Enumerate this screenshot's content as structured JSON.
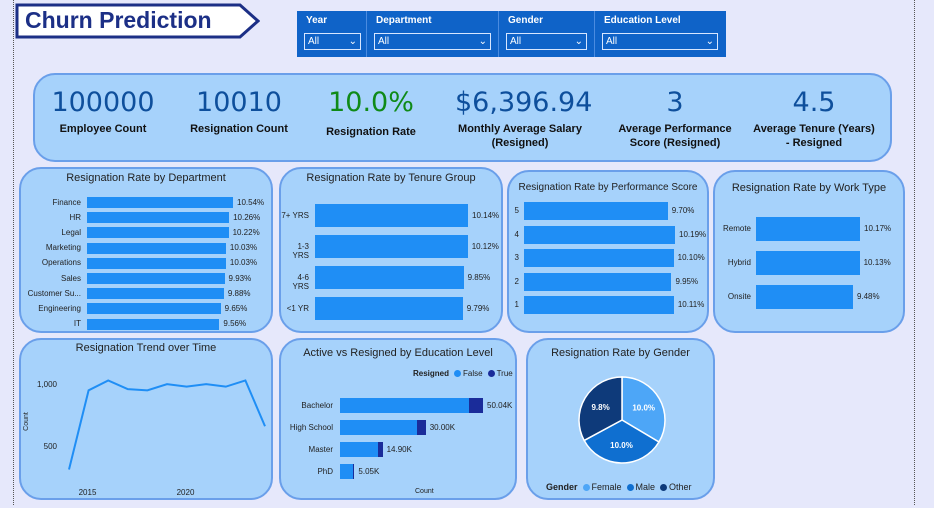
{
  "title": "Churn Prediction",
  "slicers": [
    {
      "label": "Year",
      "value": "All"
    },
    {
      "label": "Department",
      "value": "All"
    },
    {
      "label": "Gender",
      "value": "All"
    },
    {
      "label": "Education Level",
      "value": "All"
    }
  ],
  "kpis": [
    {
      "value": "100000",
      "label": "Employee Count",
      "color": "#0e4f9c"
    },
    {
      "value": "10010",
      "label": "Resignation Count",
      "color": "#0e4f9c"
    },
    {
      "value": "10.0%",
      "label": "Resignation Rate",
      "color": "#0f8a17"
    },
    {
      "value": "$6,396.94",
      "label": "Monthly Average Salary (Resigned)",
      "color": "#0e4f9c"
    },
    {
      "value": "3",
      "label": "Average Performance Score (Resigned)",
      "color": "#0e4f9c"
    },
    {
      "value": "4.5",
      "label": "Average Tenure (Years) - Resigned",
      "color": "#0e4f9c"
    }
  ],
  "chart_data": [
    {
      "type": "bar",
      "orientation": "horizontal",
      "title": "Resignation Rate by Department",
      "categories": [
        "Finance",
        "HR",
        "Legal",
        "Marketing",
        "Operations",
        "Sales",
        "Customer Su...",
        "Engineering",
        "IT"
      ],
      "values": [
        10.54,
        10.26,
        10.22,
        10.03,
        10.03,
        9.93,
        9.88,
        9.65,
        9.56
      ],
      "labels": [
        "10.54%",
        "10.26%",
        "10.22%",
        "10.03%",
        "10.03%",
        "9.93%",
        "9.88%",
        "9.65%",
        "9.56%"
      ],
      "color": "#1f8ef5"
    },
    {
      "type": "bar",
      "orientation": "horizontal",
      "title": "Resignation Rate by Tenure Group",
      "categories": [
        "7+ YRS",
        "1-3 YRS",
        "4-6 YRS",
        "<1 YR"
      ],
      "values": [
        10.14,
        10.12,
        9.85,
        9.79
      ],
      "labels": [
        "10.14%",
        "10.12%",
        "9.85%",
        "9.79%"
      ],
      "color": "#1f8ef5"
    },
    {
      "type": "bar",
      "orientation": "horizontal",
      "title": "Resignation Rate by Performance Score",
      "categories": [
        "5",
        "4",
        "3",
        "2",
        "1"
      ],
      "values": [
        9.7,
        10.19,
        10.1,
        9.95,
        10.11
      ],
      "labels": [
        "9.70%",
        "10.19%",
        "10.10%",
        "9.95%",
        "10.11%"
      ],
      "color": "#1f8ef5"
    },
    {
      "type": "bar",
      "orientation": "horizontal",
      "title": "Resignation Rate by Work Type",
      "categories": [
        "Remote",
        "Hybrid",
        "Onsite"
      ],
      "values": [
        10.17,
        10.13,
        9.48
      ],
      "labels": [
        "10.17%",
        "10.13%",
        "9.48%"
      ],
      "color": "#1f8ef5"
    },
    {
      "type": "line",
      "title": "Resignation Trend over Time",
      "ylabel": "Count",
      "x": [
        2014,
        2015,
        2016,
        2017,
        2018,
        2019,
        2020,
        2021,
        2022,
        2023,
        2024
      ],
      "values": [
        320,
        960,
        1040,
        970,
        960,
        1010,
        990,
        1010,
        990,
        1040,
        670
      ],
      "yticks": [
        "1,000",
        "500"
      ],
      "xticks": [
        "2015",
        "2020"
      ],
      "color": "#1f8ef5"
    },
    {
      "type": "bar",
      "orientation": "horizontal",
      "stacked": true,
      "title": "Active vs Resigned by Education Level",
      "xlabel": "Count",
      "legend_title": "Resigned",
      "categories": [
        "Bachelor",
        "High School",
        "Master",
        "PhD"
      ],
      "series": [
        {
          "name": "False",
          "values": [
            45040,
            27000,
            13410,
            4545
          ],
          "color": "#1f8ef5"
        },
        {
          "name": "True",
          "values": [
            5000,
            3000,
            1490,
            505
          ],
          "color": "#1a2c9a"
        }
      ],
      "labels": [
        "50.04K",
        "30.00K",
        "14.90K",
        "5.05K"
      ]
    },
    {
      "type": "pie",
      "title": "Resignation Rate by Gender",
      "legend_title": "Gender",
      "slices": [
        {
          "name": "Female",
          "value": 10.0,
          "label": "10.0%",
          "color": "#4da6f7"
        },
        {
          "name": "Male",
          "value": 10.0,
          "label": "10.0%",
          "color": "#0f6fd0"
        },
        {
          "name": "Other",
          "value": 9.8,
          "label": "9.8%",
          "color": "#0e3a7a"
        }
      ]
    }
  ]
}
